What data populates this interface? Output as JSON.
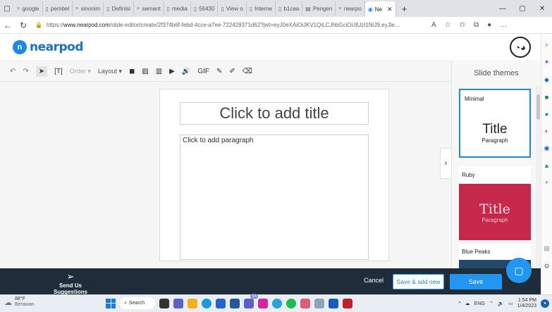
{
  "browser": {
    "tabs": [
      {
        "label": "google",
        "icon": "search-icon"
      },
      {
        "label": "pembel",
        "icon": "page-icon"
      },
      {
        "label": "sinonim",
        "icon": "search-icon"
      },
      {
        "label": "Definisi",
        "icon": "page-icon"
      },
      {
        "label": "semant",
        "icon": "search-icon"
      },
      {
        "label": "media",
        "icon": "page-icon"
      },
      {
        "label": "56430",
        "icon": "page-icon"
      },
      {
        "label": "View o",
        "icon": "page-icon"
      },
      {
        "label": "Interne",
        "icon": "page-icon"
      },
      {
        "label": "b1caa",
        "icon": "page-icon"
      },
      {
        "label": "Pengen",
        "icon": "pdf-icon"
      },
      {
        "label": "nearpo",
        "icon": "search-icon"
      },
      {
        "label": "Ne",
        "icon": "nearpod-icon",
        "active": true
      }
    ],
    "url_prefix": "https://",
    "url_host": "www.nearpod.com",
    "url_path": "/slide-editor/create/2f374b6f-febd-4cce-a7ee-722429371d62?jwt=eyJ0eXAiOiJKV1QiLCJhbGciOiJIUzI1NiJ9.eyJle..."
  },
  "app": {
    "logo_text": "nearpod"
  },
  "toolbar": {
    "order_label": "Order",
    "layout_label": "Layout",
    "gif_label": "GIF"
  },
  "slide": {
    "title_placeholder": "Click to add title",
    "paragraph_placeholder": "Click to add paragraph"
  },
  "themes": {
    "heading": "Slide themes",
    "items": [
      {
        "name": "Minimal",
        "title": "Title",
        "paragraph": "Paragraph",
        "color": "#ffffff",
        "selected": true
      },
      {
        "name": "Ruby",
        "title": "Title",
        "paragraph": "Paragraph",
        "color": "#c5284a",
        "selected": false
      },
      {
        "name": "Blue Peaks",
        "color": "#234a6b",
        "selected": false
      }
    ]
  },
  "bottom": {
    "suggestions_label": "Send Us Suggestions",
    "cancel_label": "Cancel",
    "save_add_label": "Save & add new",
    "save_label": "Save"
  },
  "taskbar": {
    "temperature": "88°F",
    "condition": "Berawan",
    "search_label": "Search",
    "badge_count": "56",
    "language": "ENG",
    "time": "1:54 PM",
    "date": "1/4/2023"
  },
  "colors": {
    "accent": "#2196f3",
    "bottom_bar": "#1f2d3a",
    "ruby": "#c5284a"
  }
}
